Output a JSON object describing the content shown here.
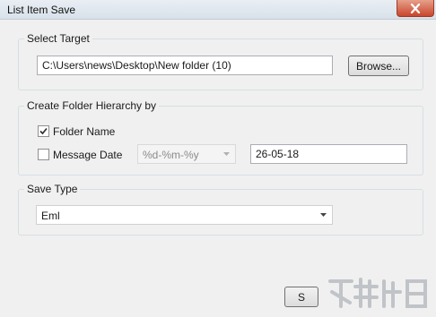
{
  "window": {
    "title": "List Item Save"
  },
  "select_target": {
    "legend": "Select Target",
    "path_value": "C:\\Users\\news\\Desktop\\New folder (10)",
    "browse_label": "Browse..."
  },
  "hierarchy": {
    "legend": "Create Folder Hierarchy by",
    "folder_name": {
      "label": "Folder Name",
      "checked": true
    },
    "message_date": {
      "label": "Message Date",
      "checked": false
    },
    "date_format": "%d-%m-%y",
    "date_preview": "26-05-18"
  },
  "save_type": {
    "legend": "Save Type",
    "selected": "Eml"
  },
  "footer": {
    "save_button_label": "S"
  },
  "icons": {
    "close": "close-icon",
    "check": "check-icon",
    "dropdown": "chevron-down-icon"
  },
  "colors": {
    "title_gradient_top": "#e9eef4",
    "close_button": "#c9462c",
    "group_border": "#d5dfe5"
  }
}
